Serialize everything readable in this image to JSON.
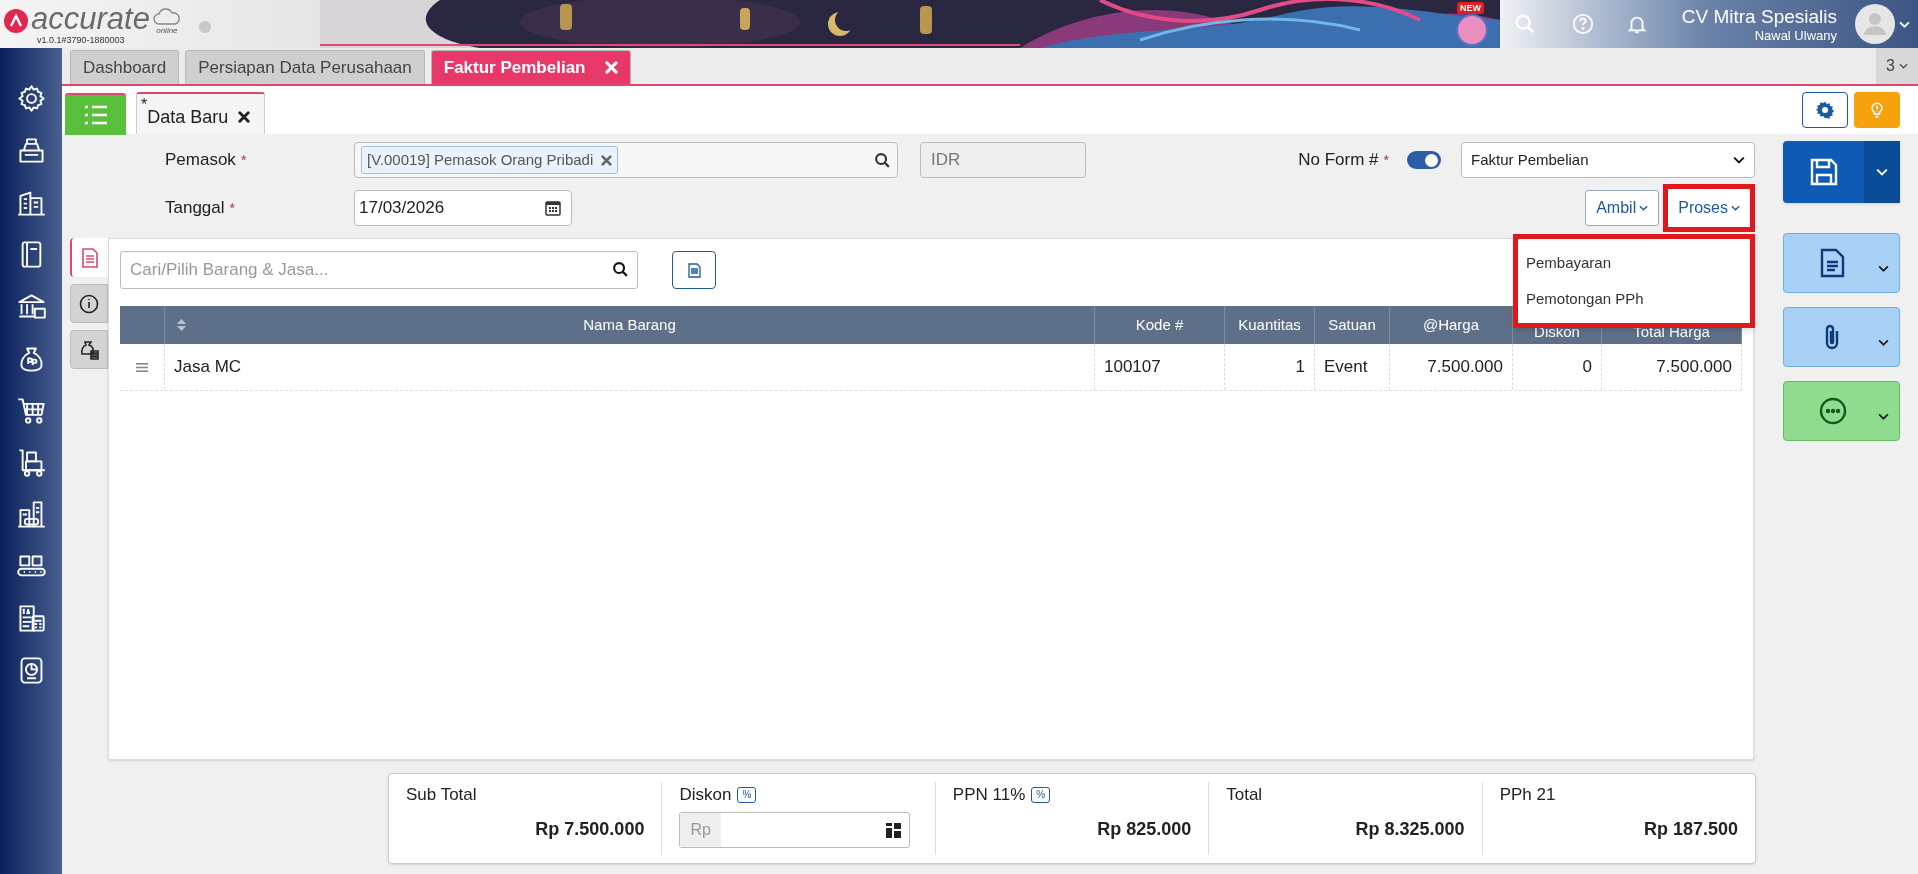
{
  "header": {
    "logo": "accurate",
    "logo_sub": "online",
    "version": "v1.0.1#3790-1880003",
    "new_badge": "NEW",
    "company": "CV Mitra Spesialis",
    "user": "Nawal Ulwany"
  },
  "tabs": [
    {
      "label": "Dashboard",
      "selected": false,
      "closable": false
    },
    {
      "label": "Persiapan Data Perusahaan",
      "selected": false,
      "closable": false
    },
    {
      "label": "Faktur Pembelian",
      "selected": true,
      "closable": true
    }
  ],
  "tab_count": "3",
  "subtabs": [
    {
      "label": "Data Baru",
      "marker": "*",
      "selected": true
    }
  ],
  "form": {
    "supplier": {
      "label": "Pemasok",
      "required_mark": "*",
      "tag": "[V.00019] Pemasok Orang Pribadi"
    },
    "currency": "IDR",
    "form_no": {
      "label": "No Form #",
      "required_mark": "*",
      "toggle_on": true,
      "type": "Faktur Pembelian"
    },
    "date": {
      "label": "Tanggal",
      "required_mark": "*",
      "value": "17/03/2026"
    }
  },
  "actions": [
    {
      "label": "Ambil",
      "highlighted": false
    },
    {
      "label": "Proses",
      "highlighted": true
    }
  ],
  "process_menu": {
    "highlighted": true,
    "items": [
      "Pembayaran",
      "Pemotongan PPh"
    ]
  },
  "side_tabs": [
    {
      "kind": "detail",
      "selected": true
    },
    {
      "kind": "info",
      "selected": false
    },
    {
      "kind": "cost",
      "selected": false
    }
  ],
  "item_search": {
    "placeholder": "Cari/Pilih Barang & Jasa..."
  },
  "table": {
    "columns": [
      "Nama Barang",
      "Kode #",
      "Kuantitas",
      "Satuan",
      "@Harga",
      "Diskon",
      "Total Harga"
    ],
    "rows": [
      [
        "Jasa MC",
        "100107",
        "1",
        "Event",
        "7.500.000",
        "0",
        "7.500.000"
      ]
    ]
  },
  "totals": [
    {
      "kind": "amount",
      "label": "Sub Total",
      "value": "Rp 7.500.000"
    },
    {
      "kind": "input",
      "label": "Diskon",
      "badge": "%",
      "prefix": "Rp"
    },
    {
      "kind": "amount",
      "label": "PPN 11%",
      "badge": "%",
      "value": "Rp 825.000"
    },
    {
      "kind": "amount",
      "label": "Total",
      "value": "Rp 8.325.000"
    },
    {
      "kind": "amount",
      "label": "PPh 21",
      "value": "Rp 187.500"
    }
  ]
}
